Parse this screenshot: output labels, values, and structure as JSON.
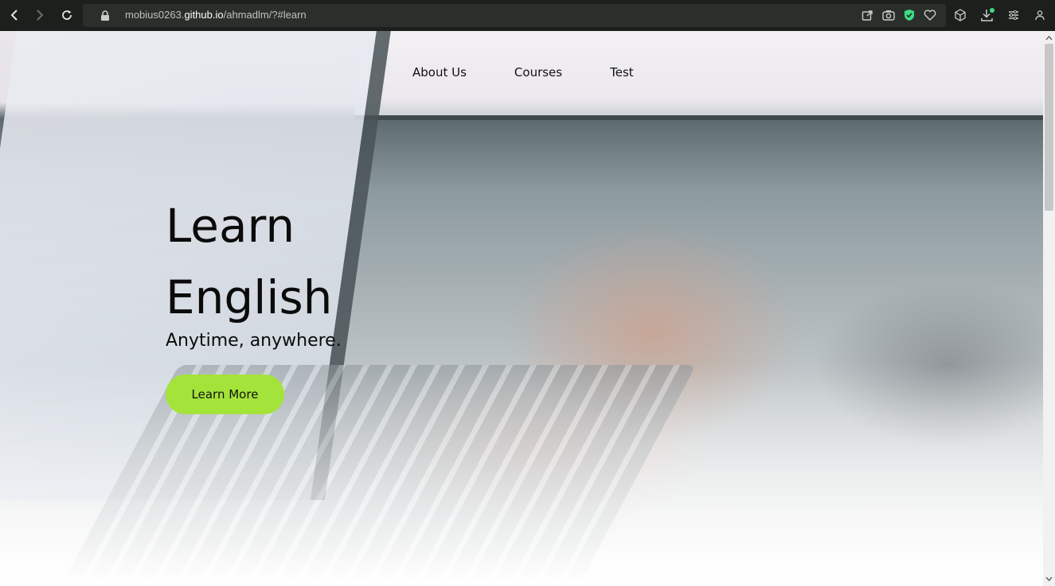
{
  "browser": {
    "url_prefix": "mobius0263.",
    "url_host": "github.io",
    "url_path": "/ahmadlm/?#learn",
    "icons": {
      "back": "back-arrow-icon",
      "forward": "forward-arrow-icon",
      "reload": "reload-icon",
      "lock": "lock-icon",
      "share": "share-icon",
      "screenshot": "camera-icon",
      "shield": "shield-icon",
      "favorite": "heart-icon",
      "extensions": "cube-icon",
      "downloads": "download-icon",
      "menu": "menu-icon",
      "profile": "profile-icon"
    },
    "colors": {
      "chrome_bg": "#1c1f1c",
      "shield": "#3ddc84",
      "download_badge": "#3ddc84"
    }
  },
  "nav": {
    "items": [
      {
        "label": "About Us"
      },
      {
        "label": "Courses"
      },
      {
        "label": "Test"
      }
    ]
  },
  "hero": {
    "title_line1": "Learn",
    "title_line2": "English",
    "subtitle": "Anytime, anywhere.",
    "cta_label": "Learn More",
    "cta_color": "#a4e33a"
  }
}
